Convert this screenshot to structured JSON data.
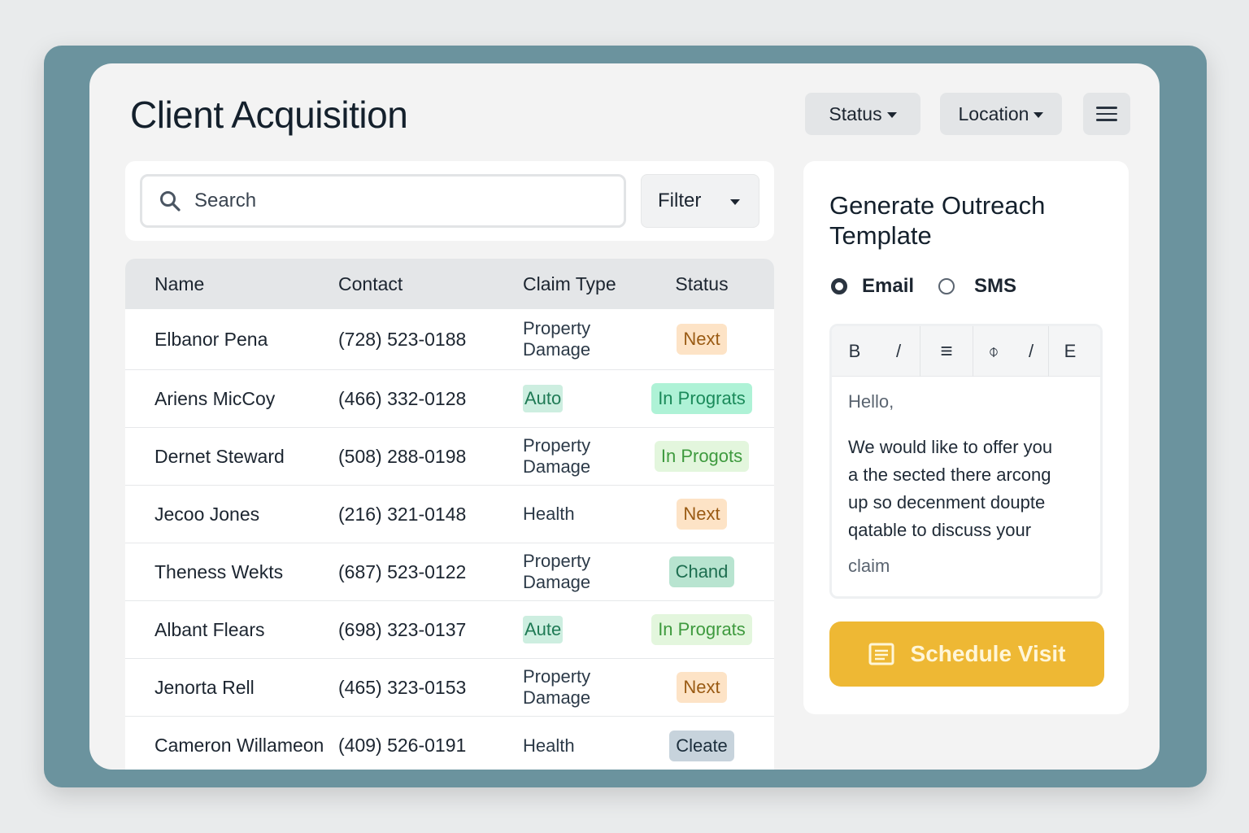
{
  "header": {
    "title": "Client Acquisition",
    "status_dropdown": "Status",
    "location_dropdown": "Location",
    "menu_icon": "hamburger-menu-icon"
  },
  "search": {
    "placeholder": "Search",
    "filter_label": "Filter"
  },
  "table": {
    "columns": {
      "name": "Name",
      "contact": "Contact",
      "claim_type": "Claim Type",
      "status": "Status"
    },
    "rows": [
      {
        "name": "Elbanor Pena",
        "contact": "(728) 523-0188",
        "claim_line1": "Property",
        "claim_line2": "Damage",
        "status": "Next"
      },
      {
        "name": "Ariens MicCoy",
        "contact": "(466) 332-0128",
        "claim": "Auto",
        "status": "In Prograts"
      },
      {
        "name": "Dernet Steward",
        "contact": "(508) 288-0198",
        "claim_line1": "Property",
        "claim_line2": "Damage",
        "status": "In Progots"
      },
      {
        "name": "Jecoo Jones",
        "contact": "(216) 321-0148",
        "claim": "Health",
        "status": "Next"
      },
      {
        "name": "Theness Wekts",
        "contact": "(687) 523-0122",
        "claim_line1": "Property",
        "claim_line2": "Damage",
        "status": "Chand"
      },
      {
        "name": "Albant Flears",
        "contact": "(698) 323-0137",
        "claim": "Aute",
        "status": "In Prograts"
      },
      {
        "name": "Jenorta Rell",
        "contact": "(465) 323-0153",
        "claim_line1": "Property",
        "claim_line2": "Damage",
        "status": "Next"
      },
      {
        "name": "Cameron Willameon",
        "contact": "(409) 526-0191",
        "claim": "Health",
        "status": "Cleate"
      }
    ]
  },
  "outreach": {
    "title": "Generate Outreach Template",
    "channel_email": "Email",
    "channel_sms": "SMS",
    "selected_channel": "Email",
    "toolbar": {
      "bold": "B",
      "italic": "/",
      "align": "≡",
      "link": "⌽",
      "slash": "/",
      "e": "E"
    },
    "greeting": "Hello,",
    "body_line1": "We would like to offer you",
    "body_line2": "a the sected there arcong",
    "body_line3": "up so decenment doupte",
    "body_line4": "qatable to discuss your",
    "closing": "claim",
    "schedule_label": "Schedule Visit",
    "schedule_icon": "calendar-note-icon"
  },
  "colors": {
    "frame": "#6b939e",
    "accent_button": "#eeb834",
    "badge_next_bg": "#fde3c6",
    "badge_progress_bg": "#aef2d6"
  }
}
